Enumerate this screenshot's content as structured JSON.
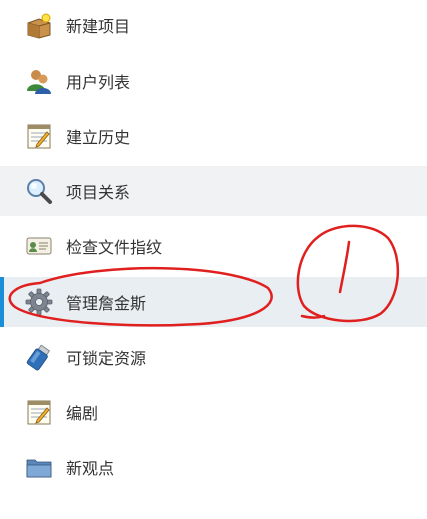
{
  "sidebar": {
    "items": [
      {
        "label": "新建项目",
        "icon": "new-project-box-icon"
      },
      {
        "label": "用户列表",
        "icon": "users-icon"
      },
      {
        "label": "建立历史",
        "icon": "notepad-history-icon"
      },
      {
        "label": "项目关系",
        "icon": "magnifier-icon"
      },
      {
        "label": "检查文件指纹",
        "icon": "fingerprint-card-icon"
      },
      {
        "label": "管理詹金斯",
        "icon": "gear-icon"
      },
      {
        "label": "可锁定资源",
        "icon": "usb-drive-icon"
      },
      {
        "label": "编剧",
        "icon": "notepad-pencil-icon"
      },
      {
        "label": "新观点",
        "icon": "folder-icon"
      }
    ]
  },
  "colors": {
    "active_bar": "#1a8fd7",
    "active_bg": "#e9eef2",
    "hover_bg": "#f1f2f3",
    "annotation": "#e0201f"
  }
}
